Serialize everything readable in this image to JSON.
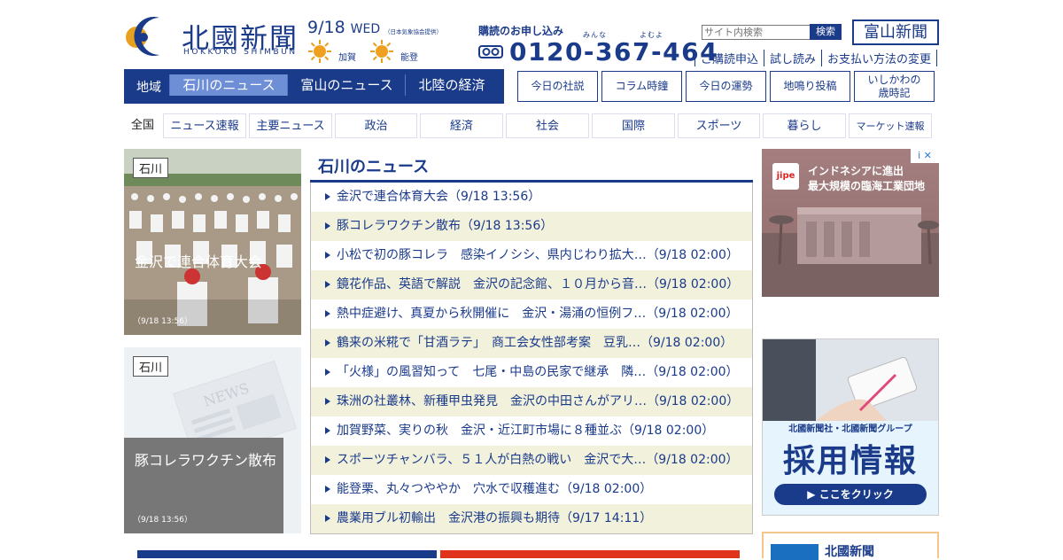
{
  "brand": {
    "logo_text": "北國新聞",
    "logo_sub": "HOKKOKU SHIMBUN"
  },
  "date": {
    "day": "9/18",
    "weekday": "WED",
    "source_note": "（日本気象協会提供）"
  },
  "weather": [
    {
      "place": "加賀",
      "icon": "sun-icon"
    },
    {
      "place": "能登",
      "icon": "sun-icon"
    }
  ],
  "subscribe": {
    "title": "購読のお申し込み",
    "ruby_a": "みんな",
    "ruby_b": "よむよ",
    "phone": "0120-367-464",
    "links": [
      "ご購読申込",
      "試し読み",
      "お支払い方法の変更"
    ]
  },
  "search": {
    "placeholder": "サイト内検索",
    "button": "検索"
  },
  "toyama_link": "富山新聞",
  "region_nav": {
    "label": "地域",
    "tabs": [
      "石川のニュース",
      "富山のニュース",
      "北陸の経済"
    ],
    "active": 0
  },
  "boxes": [
    "今日の社説",
    "コラム時鐘",
    "今日の運勢",
    "地鳴り投稿",
    "いしかわの",
    "歳時記"
  ],
  "categories": [
    "全国",
    "ニュース速報",
    "主要ニュース",
    "政治",
    "経済",
    "社会",
    "国際",
    "スポーツ",
    "暮らし",
    "マーケット速報"
  ],
  "photos": [
    {
      "tag": "石川",
      "title": "金沢で連合体育大会",
      "time": "（9/18 13:56）"
    },
    {
      "tag": "石川",
      "title": "豚コレラワクチン散布",
      "time": "（9/18 13:56）",
      "watermark": "NEWS"
    }
  ],
  "news": {
    "title": "石川のニュース",
    "items": [
      "金沢で連合体育大会（9/18 13:56）",
      "豚コレラワクチン散布（9/18 13:56）",
      "小松で初の豚コレラ　感染イノシシ、県内じわり拡大…（9/18 02:00）",
      "鏡花作品、英語で解説　金沢の記念館、１０月から音…（9/18 02:00）",
      "熱中症避け、真夏から秋開催に　金沢・湯涌の恒例フ…（9/18 02:00）",
      "鶴来の米糀で「甘酒ラテ」　商工会女性部考案　豆乳…（9/18 02:00）",
      "「火様」の風習知って　七尾・中島の民家で継承　隣…（9/18 02:00）",
      "珠洲の社叢林、新種甲虫発見　金沢の中田さんがアリ…（9/18 02:00）",
      "加賀野菜、実りの秋　金沢・近江町市場に８種並ぶ（9/18 02:00）",
      "スポーツチャンバラ、５１人が白熱の戦い　金沢で大…（9/18 02:00）",
      "能登栗、丸々つややか　穴水で収穫進む（9/18 02:00）",
      "農業用ブル初輸出　金沢港の振興も期待（9/17 14:11）"
    ]
  },
  "ads": {
    "ad1": {
      "brand": "jipe",
      "line1": "インドネシアに進出",
      "line2": "最大規模の臨海工業団地",
      "choices": "i ✕"
    },
    "ad2": {
      "company": "北國新聞社・北國新聞グループ",
      "headline": "採用情報",
      "cta": "▶ ここをクリック"
    },
    "ad3": {
      "title": "北國新聞"
    }
  },
  "colors": {
    "brand": "#1a3a8a",
    "accent": "#e8a020",
    "stripe": "#f1f1dc"
  }
}
